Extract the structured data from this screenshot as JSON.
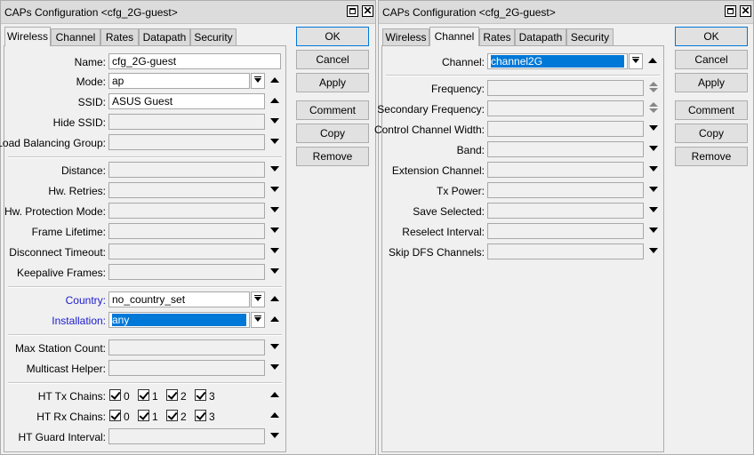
{
  "left": {
    "title": "CAPs Configuration <cfg_2G-guest>",
    "tabs": [
      "Wireless",
      "Channel",
      "Rates",
      "Datapath",
      "Security"
    ],
    "fields": {
      "name": {
        "label": "Name:",
        "value": "cfg_2G-guest"
      },
      "mode": {
        "label": "Mode:",
        "value": "ap"
      },
      "ssid": {
        "label": "SSID:",
        "value": "ASUS Guest"
      },
      "hide_ssid": {
        "label": "Hide SSID:",
        "value": ""
      },
      "load_balancing": {
        "label": "Load Balancing Group:",
        "value": ""
      },
      "distance": {
        "label": "Distance:",
        "value": ""
      },
      "hw_retries": {
        "label": "Hw. Retries:",
        "value": ""
      },
      "hw_protection": {
        "label": "Hw. Protection Mode:",
        "value": ""
      },
      "frame_lifetime": {
        "label": "Frame Lifetime:",
        "value": ""
      },
      "disconnect_timeout": {
        "label": "Disconnect Timeout:",
        "value": ""
      },
      "keepalive": {
        "label": "Keepalive Frames:",
        "value": ""
      },
      "country": {
        "label": "Country:",
        "value": "no_country_set"
      },
      "installation": {
        "label": "Installation:",
        "value": "any"
      },
      "max_station": {
        "label": "Max Station Count:",
        "value": ""
      },
      "multicast": {
        "label": "Multicast Helper:",
        "value": ""
      },
      "ht_tx": {
        "label": "HT Tx Chains:",
        "chains": [
          "0",
          "1",
          "2",
          "3"
        ]
      },
      "ht_rx": {
        "label": "HT Rx Chains:",
        "chains": [
          "0",
          "1",
          "2",
          "3"
        ]
      },
      "ht_guard": {
        "label": "HT Guard Interval:",
        "value": ""
      }
    },
    "buttons": [
      "OK",
      "Cancel",
      "Apply",
      "Comment",
      "Copy",
      "Remove"
    ]
  },
  "right": {
    "title": "CAPs Configuration <cfg_2G-guest>",
    "tabs": [
      "Wireless",
      "Channel",
      "Rates",
      "Datapath",
      "Security"
    ],
    "fields": {
      "channel": {
        "label": "Channel:",
        "value": "channel2G"
      },
      "frequency": {
        "label": "Frequency:",
        "value": ""
      },
      "secondary_frequency": {
        "label": "Secondary Frequency:",
        "value": ""
      },
      "control_channel_width": {
        "label": "Control Channel Width:",
        "value": ""
      },
      "band": {
        "label": "Band:",
        "value": ""
      },
      "extension_channel": {
        "label": "Extension Channel:",
        "value": ""
      },
      "tx_power": {
        "label": "Tx Power:",
        "value": ""
      },
      "save_selected": {
        "label": "Save Selected:",
        "value": ""
      },
      "reselect_interval": {
        "label": "Reselect Interval:",
        "value": ""
      },
      "skip_dfs": {
        "label": "Skip DFS Channels:",
        "value": ""
      }
    },
    "buttons": [
      "OK",
      "Cancel",
      "Apply",
      "Comment",
      "Copy",
      "Remove"
    ]
  },
  "colors": {
    "selection": "#0078d7",
    "label_blue": "#1a1acc"
  }
}
